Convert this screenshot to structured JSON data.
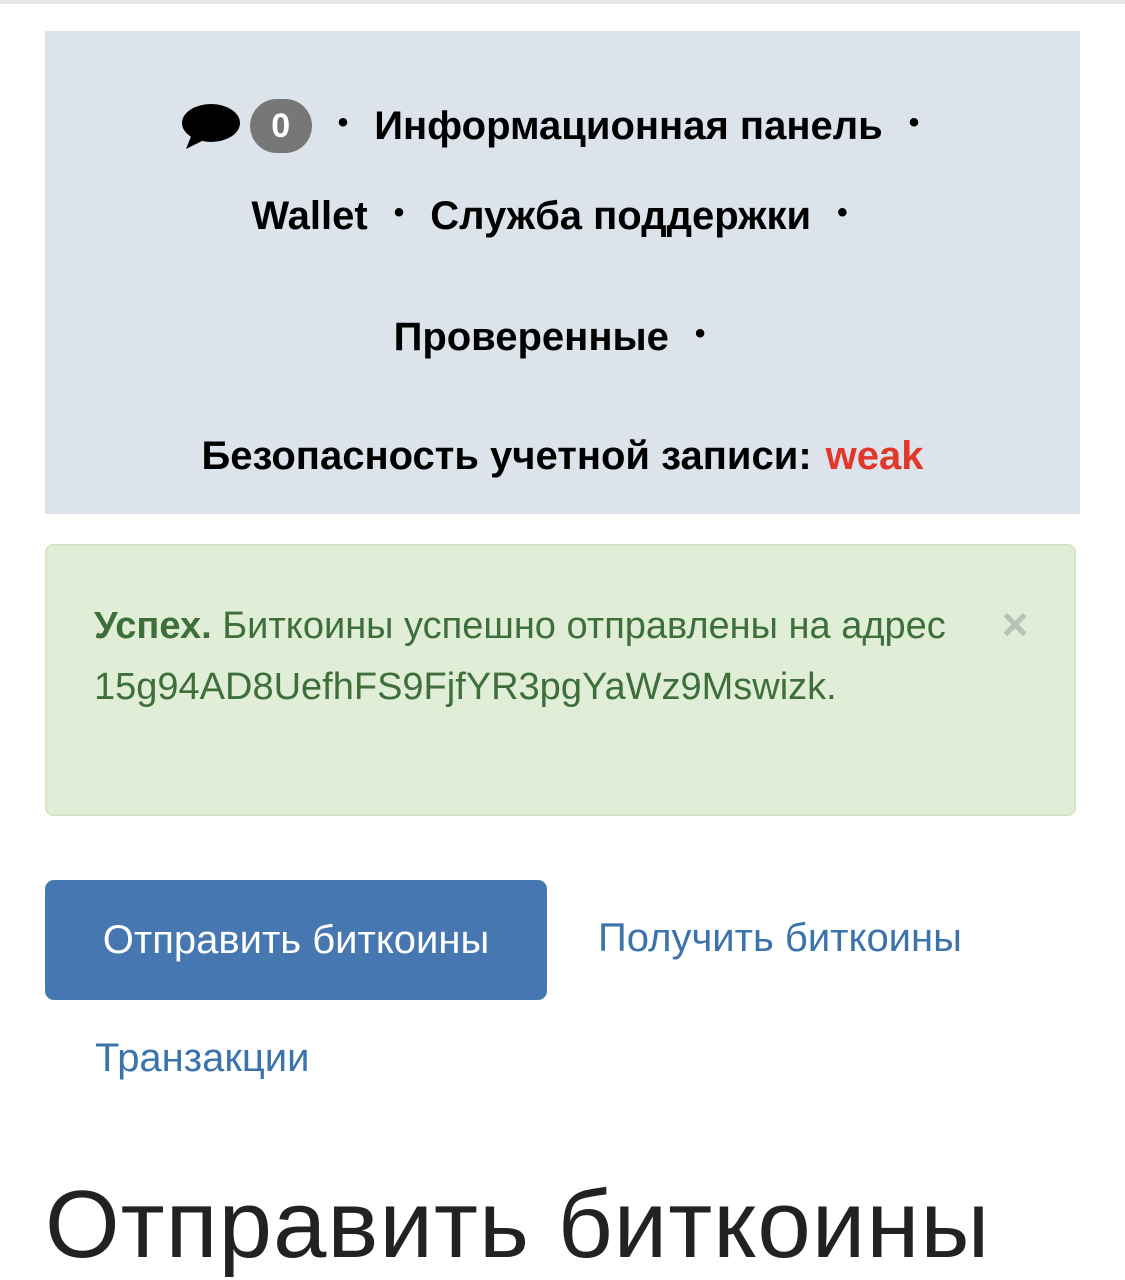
{
  "nav": {
    "message_count": "0",
    "separator": "•",
    "dashboard": "Информационная панель",
    "wallet": "Wallet",
    "support": "Служба поддержки",
    "verified": "Проверенные",
    "security_label": "Безопасность учетной записи:",
    "security_value": "weak"
  },
  "alert": {
    "title": "Успех.",
    "message": "Биткоины успешно отправлены на адрес 15g94AD8UefhFS9FjfYR3pgYaWz9Mswizk.",
    "close": "×"
  },
  "actions": {
    "send": "Отправить биткоины",
    "receive": "Получить биткоины",
    "transactions": "Транзакции"
  },
  "page": {
    "heading": "Отправить биткоины"
  },
  "colors": {
    "nav_bg": "#dde3ea",
    "weak": "#e0392b",
    "alert_bg": "#e0eed7",
    "alert_text": "#3e6f3a",
    "primary": "#4677b0",
    "link": "#3b73ac"
  },
  "icons": {
    "messages": "speech-bubble-icon",
    "close": "close-icon"
  }
}
